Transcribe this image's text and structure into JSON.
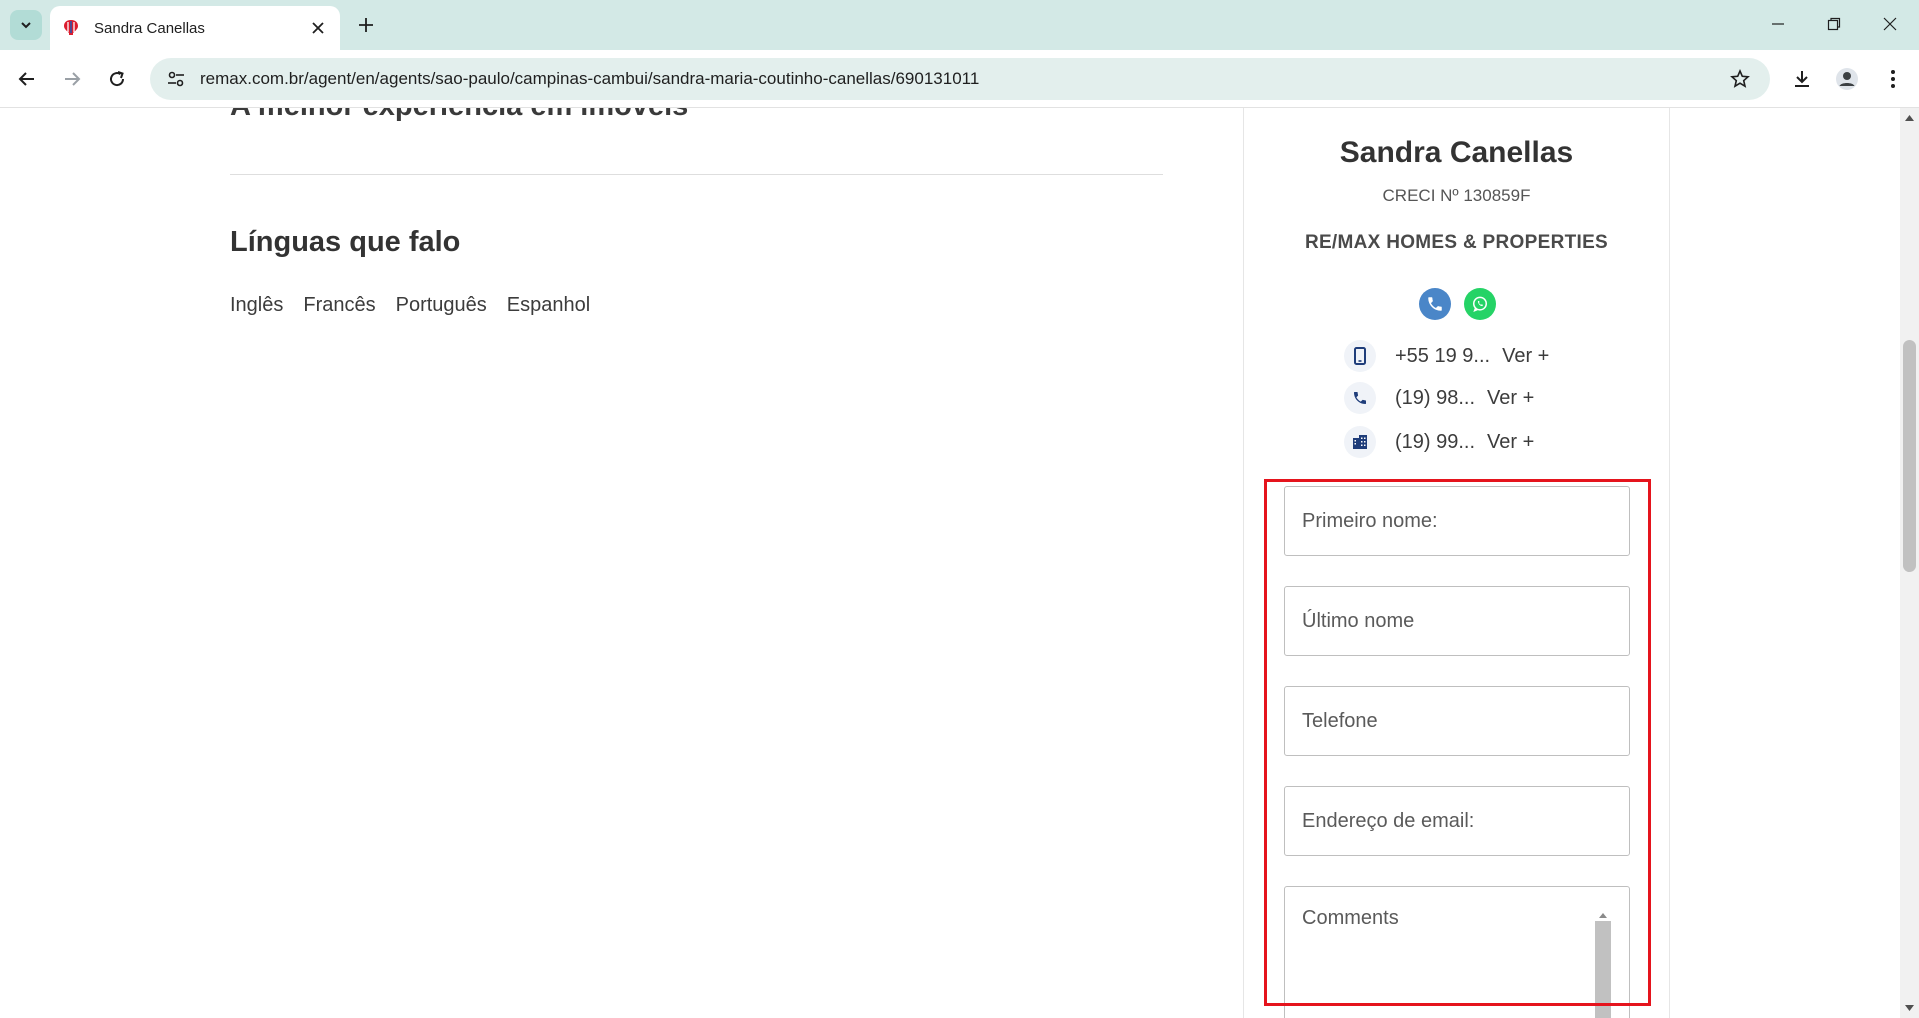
{
  "browser": {
    "tab_title": "Sandra Canellas",
    "url": "remax.com.br/agent/en/agents/sao-paulo/campinas-cambui/sandra-maria-coutinho-canellas/690131011",
    "brand_colors": {
      "remax_red": "#dc1c2e",
      "remax_blue": "#003da5"
    }
  },
  "page": {
    "cut_heading": "A melhor experiência em imóveis",
    "languages_title": "Línguas que falo",
    "languages": [
      "Inglês",
      "Francês",
      "Português",
      "Espanhol"
    ]
  },
  "agent": {
    "name": "Sandra Canellas",
    "creci": "CRECI Nº 130859F",
    "office": "RE/MAX HOMES & PROPERTIES",
    "phones": [
      {
        "icon": "mobile-phone-icon",
        "number": "+55 19 9...",
        "more": "Ver +"
      },
      {
        "icon": "phone-icon",
        "number": "(19) 98...",
        "more": "Ver +"
      },
      {
        "icon": "office-building-icon",
        "number": "(19) 99...",
        "more": "Ver +"
      }
    ],
    "call_color": "#4a86c8",
    "whatsapp_color": "#25d366"
  },
  "form": {
    "first_name_placeholder": "Primeiro nome:",
    "last_name_placeholder": "Último nome",
    "phone_placeholder": "Telefone",
    "email_placeholder": "Endereço de email:",
    "comments_placeholder": "Comments"
  },
  "annotation": {
    "highlight_color": "#e5141d"
  }
}
